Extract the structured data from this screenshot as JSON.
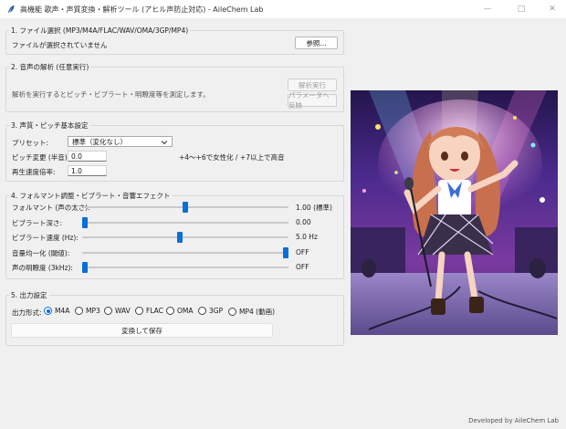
{
  "window": {
    "title": "高機能 歌声・声質変換・解析ツール (アヒル声防止対応) - AileChem Lab",
    "minimize_glyph": "—",
    "maximize_glyph": "□",
    "close_glyph": "✕"
  },
  "section1": {
    "legend": "1. ファイル選択 (MP3/M4A/FLAC/WAV/OMA/3GP/MP4)",
    "status": "ファイルが選択されていません",
    "browse_label": "参照..."
  },
  "section2": {
    "legend": "2. 音声の解析 (任意実行)",
    "description": "解析を実行するとピッチ・ビブラート・明瞭度等を測定します。",
    "analyze_label": "解析実行",
    "apply_label": "パラメータへ反映"
  },
  "section3": {
    "legend": "3. 声質・ピッチ基本設定",
    "preset_label": "プリセット:",
    "preset_value": "標準（変化なし）",
    "pitch_label": "ピッチ変更 (半音):",
    "pitch_value": "0.0",
    "pitch_hint": "+4～+6で女性化 / +7以上で高音",
    "speed_label": "再生速度倍率:",
    "speed_value": "1.0"
  },
  "section4": {
    "legend": "4. フォルマント調整・ビブラート・音響エフェクト",
    "sliders": [
      {
        "label": "フォルマント (声の太さ):",
        "value_text": "1.00 (標準)",
        "position": 0.5
      },
      {
        "label": "ビブラート深さ:",
        "value_text": "0.00",
        "position": 0.0
      },
      {
        "label": "ビブラート速度 (Hz):",
        "value_text": "5.0 Hz",
        "position": 0.4737
      },
      {
        "label": "音量均一化 (閾値):",
        "value_text": "OFF",
        "position": 1.0
      },
      {
        "label": "声の明瞭度 (3kHz):",
        "value_text": "OFF",
        "position": 0.0
      }
    ]
  },
  "section5": {
    "legend": "5. 出力設定",
    "format_label": "出力形式:",
    "formats": [
      "M4A",
      "MP3",
      "WAV",
      "FLAC",
      "OMA",
      "3GP",
      "MP4 (動画)"
    ],
    "selected_format": "M4A",
    "convert_label": "変換して保存"
  },
  "footer": "Developed by AileChem Lab",
  "colors": {
    "accent": "#0a6fd6",
    "background": "#f0f0f0"
  },
  "preview_image": "anime-singer-illustration"
}
